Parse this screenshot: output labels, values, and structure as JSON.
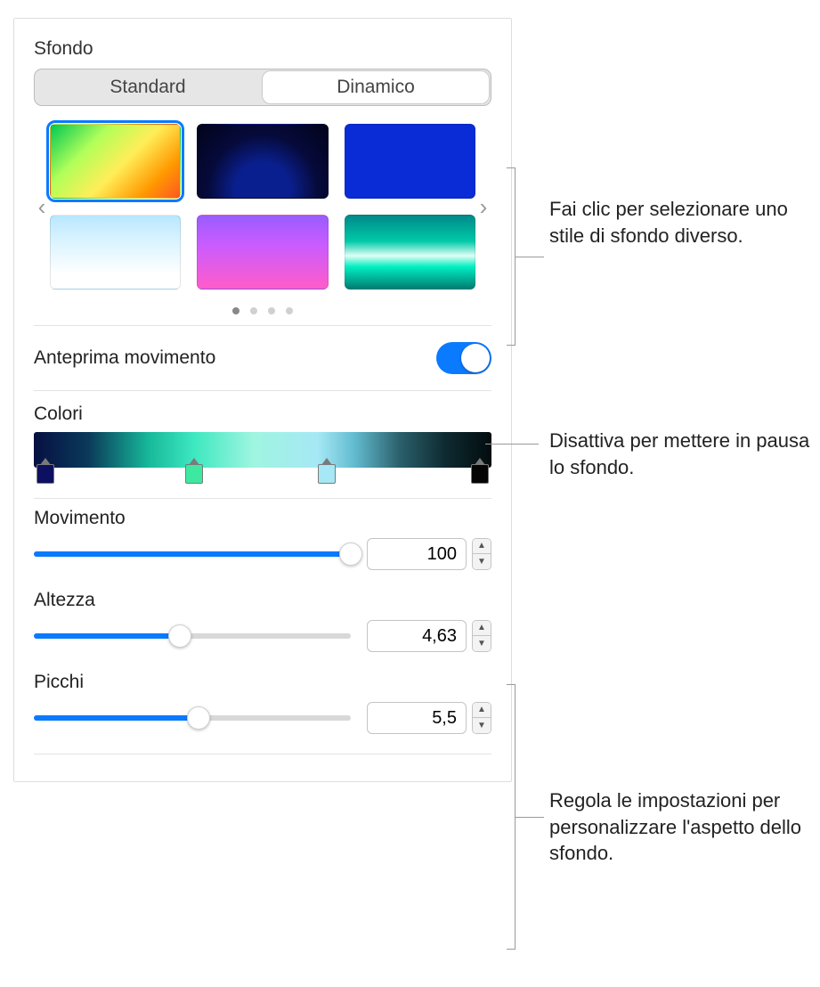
{
  "section_title": "Sfondo",
  "segmented": {
    "standard": "Standard",
    "dynamic": "Dinamico",
    "active": "dynamic"
  },
  "styles_selected_index": 0,
  "page_dots": {
    "count": 4,
    "active": 0
  },
  "motion_preview": {
    "label": "Anteprima movimento",
    "on": true
  },
  "colors": {
    "label": "Colori",
    "stops": [
      "#0d1060",
      "#3de8a0",
      "#a6e8f5",
      "#050505"
    ]
  },
  "sliders": {
    "movement": {
      "label": "Movimento",
      "value": "100",
      "percent": 100
    },
    "height": {
      "label": "Altezza",
      "value": "4,63",
      "percent": 46
    },
    "peaks": {
      "label": "Picchi",
      "value": "5,5",
      "percent": 52
    }
  },
  "callouts": {
    "styles": "Fai clic per selezionare uno stile di sfondo diverso.",
    "toggle": "Disattiva per mettere in pausa lo sfondo.",
    "sliders": "Regola le impostazioni per personalizzare l'aspetto dello sfondo."
  }
}
